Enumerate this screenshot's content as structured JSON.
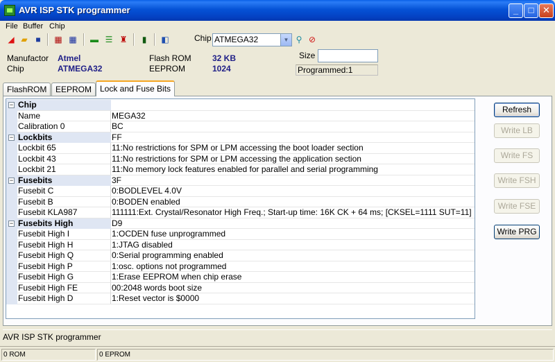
{
  "window": {
    "title": "AVR ISP STK programmer",
    "minimize": "_",
    "maximize": "□",
    "close": "✕"
  },
  "menu": [
    "File",
    "Buffer",
    "Chip"
  ],
  "toolbar": {
    "chip_label": "Chip",
    "chip_value": "ATMEGA32"
  },
  "info": {
    "manufactor_label": "Manufactor",
    "manufactor_value": "Atmel",
    "chip_label": "Chip",
    "chip_value": "ATMEGA32",
    "flash_label": "Flash ROM",
    "flash_value": "32 KB",
    "eeprom_label": "EEPROM",
    "eeprom_value": "1024",
    "size_label": "Size",
    "size_value": "",
    "programmed": "Programmed:1"
  },
  "tabs": [
    "FlashROM",
    "EEPROM",
    "Lock and Fuse Bits"
  ],
  "grid": {
    "rows": [
      {
        "type": "cat",
        "key": "Chip",
        "value": ""
      },
      {
        "type": "item",
        "key": "Name",
        "value": "MEGA32"
      },
      {
        "type": "item",
        "key": "Calibration 0",
        "value": "BC"
      },
      {
        "type": "cat",
        "key": "Lockbits",
        "value": "FF"
      },
      {
        "type": "item",
        "key": "Lockbit 65",
        "value": "11:No restrictions for SPM or LPM accessing the boot loader section"
      },
      {
        "type": "item",
        "key": "Lockbit 43",
        "value": "11:No restrictions for SPM or LPM accessing the application section"
      },
      {
        "type": "item",
        "key": "Lockbit 21",
        "value": "11:No memory lock features enabled for parallel and serial programming"
      },
      {
        "type": "cat",
        "key": "Fusebits",
        "value": "3F"
      },
      {
        "type": "item",
        "key": "Fusebit C",
        "value": "0:BODLEVEL 4.0V"
      },
      {
        "type": "item",
        "key": "Fusebit B",
        "value": "0:BODEN enabled"
      },
      {
        "type": "item",
        "key": "Fusebit KLA987",
        "value": "111111:Ext. Crystal/Resonator High Freq.; Start-up time: 16K CK + 64 ms; [CKSEL=1111 SUT=11]"
      },
      {
        "type": "cat",
        "key": "Fusebits High",
        "value": "D9"
      },
      {
        "type": "item",
        "key": "Fusebit High I",
        "value": "1:OCDEN fuse unprogrammed"
      },
      {
        "type": "item",
        "key": "Fusebit High H",
        "value": "1:JTAG disabled"
      },
      {
        "type": "item",
        "key": "Fusebit High Q",
        "value": "0:Serial programming enabled"
      },
      {
        "type": "item",
        "key": "Fusebit High P",
        "value": "1:osc. options not programmed"
      },
      {
        "type": "item",
        "key": "Fusebit High G",
        "value": "1:Erase EEPROM when chip erase"
      },
      {
        "type": "item",
        "key": "Fusebit High FE",
        "value": "00:2048 words boot size"
      },
      {
        "type": "item",
        "key": "Fusebit High D",
        "value": "1:Reset vector is $0000"
      }
    ]
  },
  "buttons": {
    "refresh": "Refresh",
    "write_lb": "Write LB",
    "write_fs": "Write FS",
    "write_fsh": "Write FSH",
    "write_fse": "Write FSE",
    "write_prg": "Write PRG"
  },
  "status": {
    "text": "AVR ISP STK programmer",
    "rom": "0 ROM",
    "eprom": "0 EPROM"
  }
}
